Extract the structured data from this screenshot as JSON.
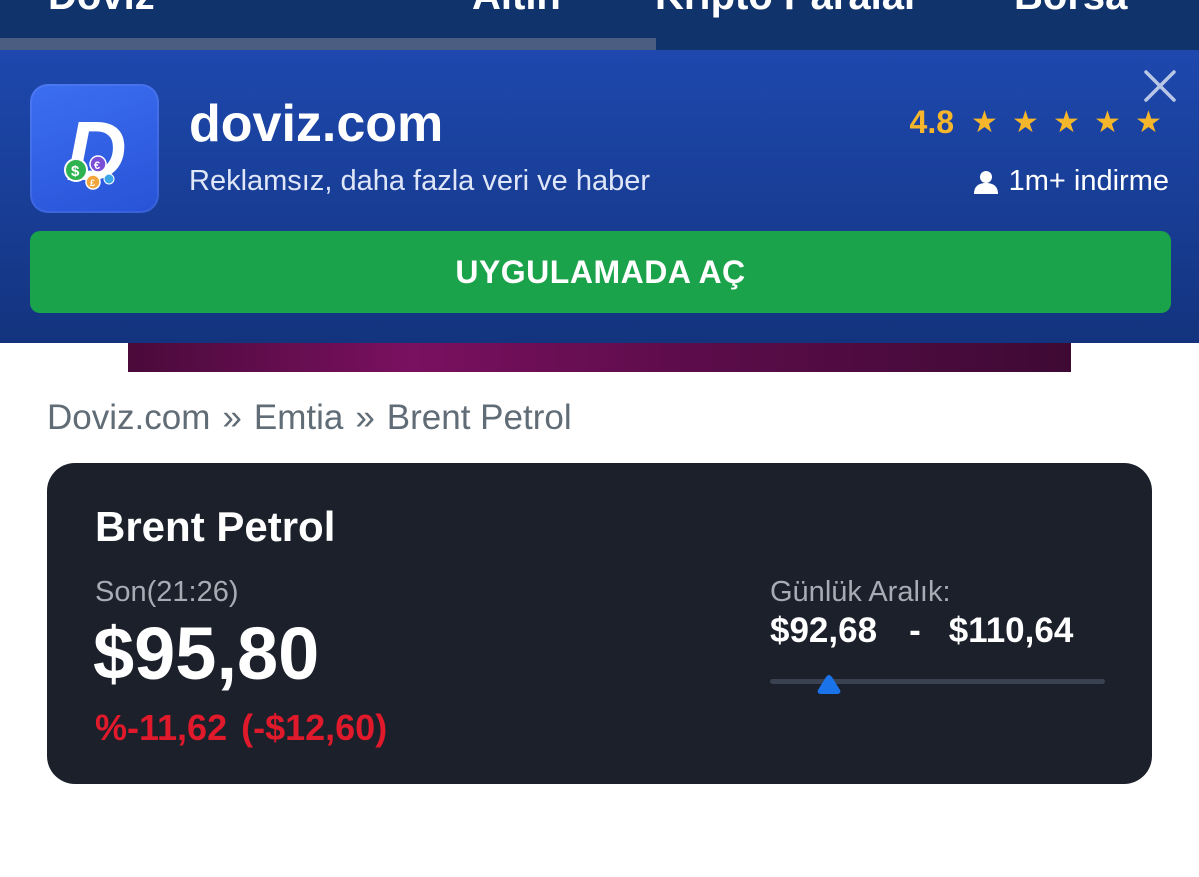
{
  "top_nav": {
    "tabs": [
      "Döviz",
      "Altın",
      "Kripto Paralar",
      "Borsa"
    ]
  },
  "banner": {
    "app_name": "doviz.com",
    "subtitle": "Reklamsız, daha fazla veri ve haber",
    "rating": "4.8",
    "stars": 5,
    "downloads": "1m+ indirme",
    "open_button": "UYGULAMADA AÇ",
    "icon_letter": "D",
    "colors": {
      "accent_star": "#f6b62b",
      "open_button": "#1aa34a",
      "banner_bg": "#1e48ae"
    }
  },
  "breadcrumb": {
    "items": [
      "Doviz.com",
      "Emtia",
      "Brent Petrol"
    ],
    "separator": "»"
  },
  "quote": {
    "title": "Brent Petrol",
    "last_label": "Son(21:26)",
    "price": "$95,80",
    "change_pct": "%-11,62",
    "change_abs": "(-$12,60)",
    "range_label": "Günlük Aralık:",
    "range_low": "$92,68",
    "range_sep": "-",
    "range_high": "$110,64",
    "range_position": 0.176,
    "colors": {
      "negative": "#e0192b",
      "thumb": "#1a73e8",
      "card_bg": "#1b202b"
    }
  }
}
